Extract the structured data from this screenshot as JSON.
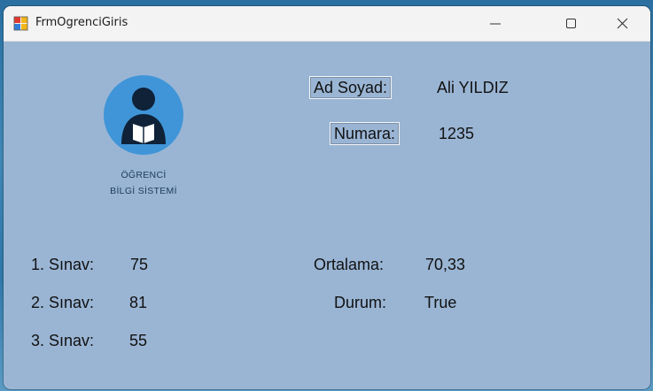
{
  "window": {
    "title": "FrmOgrenciGiris"
  },
  "logo": {
    "line1": "ÖĞRENCİ",
    "line2": "BİLGİ SİSTEMİ"
  },
  "student": {
    "name_label": "Ad Soyad:",
    "name_value": "Ali YILDIZ",
    "number_label": "Numara:",
    "number_value": "1235"
  },
  "exams": [
    {
      "label": "1. Sınav:",
      "value": "75"
    },
    {
      "label": "2. Sınav:",
      "value": "81"
    },
    {
      "label": "3. Sınav:",
      "value": "55"
    }
  ],
  "results": {
    "average_label": "Ortalama:",
    "average_value": "70,33",
    "status_label": "Durum:",
    "status_value": "True"
  },
  "colors": {
    "form_background": "#9ab5d4",
    "titlebar": "#f3f3f3",
    "logo_circle": "#3f95d8"
  },
  "icons": [
    "app-icon",
    "minimize-icon",
    "maximize-icon",
    "close-icon",
    "student-reading-icon"
  ]
}
